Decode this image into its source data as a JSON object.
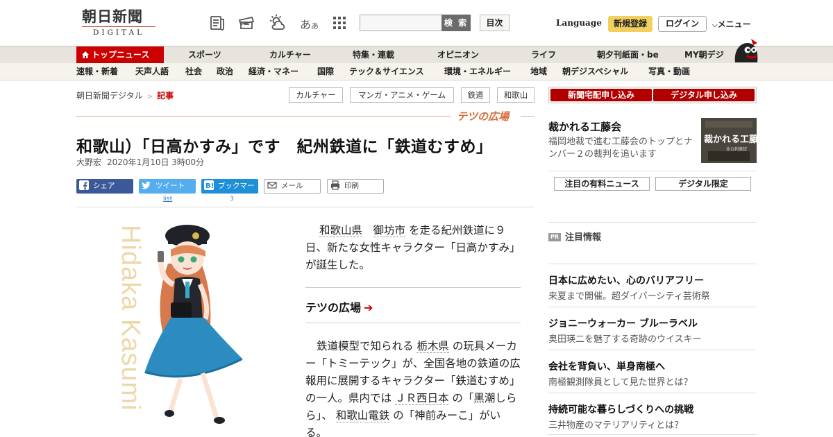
{
  "header": {
    "logo_jp": "朝日新聞",
    "logo_en": "DIGITAL",
    "font_size_mark": "あ",
    "font_size_mark_small": "あ",
    "search_placeholder": "",
    "search_button": "検 索",
    "toc_button": "目次",
    "language": "Language",
    "register_button": "新規登録",
    "login_button": "ログイン",
    "menu_button": "メニュー",
    "icons": [
      "newspaper-icon",
      "ticket-icon",
      "weather-icon",
      "font-size-icon",
      "grid-menu-icon"
    ]
  },
  "nav_primary": [
    "トップニュース",
    "スポーツ",
    "カルチャー",
    "特集・連載",
    "オピニオン",
    "ライフ",
    "朝夕刊紙面・be",
    "MY朝デジ"
  ],
  "nav_secondary": [
    "速報・新着",
    "天声人語",
    "社会",
    "政治",
    "経済・マネー",
    "国際",
    "テック＆サイエンス",
    "環境・エネルギー",
    "地域",
    "朝デジスペシャル",
    "写真・動画"
  ],
  "breadcrumb": {
    "site": "朝日新聞デジタル",
    "separator": ">",
    "current": "記事"
  },
  "tags": [
    "カルチャー",
    "マンガ・アニメ・ゲーム",
    "鉄道",
    "和歌山"
  ],
  "section_name": "テツの広場",
  "article": {
    "headline": "和歌山）「日高かすみ」です　紀州鉄道に「鉄道むすめ」",
    "author": "大野宏",
    "date": "2020年1月10日 3時00分",
    "share": {
      "facebook": "シェア",
      "twitter": "ツイート",
      "twitter_count": "list",
      "hatena": "ブックマーク",
      "hatena_count": "3",
      "mail": "メール",
      "print": "印刷"
    },
    "illustration_text": "Hidaka Kasumi",
    "p1_link1": "和歌山県",
    "p1_link2": "御坊市",
    "p1_rest": "を走る紀州鉄道に９日、新たな女性キャラクター「日高かすみ」が誕生した。",
    "related_link": "テツの広場",
    "p2_a": "鉄道模型で知られる",
    "p2_link1": "栃木県",
    "p2_b": "の玩具メーカー「トミーテック」が、全国各地の鉄道の広報用に展開するキャラクター「鉄道むすめ」の一人。県内では",
    "p2_link2": "ＪＲ西日本",
    "p2_c": "の「黒潮しらら」、",
    "p2_link3": "和歌山電鉄",
    "p2_d": "の「神前みーこ」がいる。"
  },
  "sidebar": {
    "subscribe_newspaper": "新聞宅配申し込み",
    "subscribe_digital": "デジタル申し込み",
    "feature_title": "裁かれる工藤会",
    "feature_desc": "福岡地裁で進む工藤会のトップとナンバー２の裁判を追います",
    "feature_image_title": "裁かれる工藤会",
    "feature_image_sub": "全公判速記",
    "tab_paid": "注目の有料ニュース",
    "tab_digital": "デジタル限定",
    "pr_badge": "PR",
    "pr_heading": "注目情報",
    "pr_items": [
      {
        "title": "日本に広めたい、心のバリアフリー",
        "desc": "来夏まで開催。超ダイバーシティ芸術祭"
      },
      {
        "title": "ジョニーウォーカー ブルーラベル",
        "desc": "奥田瑛二を魅了する奇跡のウイスキー"
      },
      {
        "title": "会社を背負い、単身南極へ",
        "desc": "南極観測隊員として見た世界とは？"
      },
      {
        "title": "持続可能な暮らしづくりへの挑戦",
        "desc": "三井物産のマテリアリティとは？"
      }
    ]
  },
  "colors": {
    "brand_red": "#c00000",
    "nav_bg": "#e6e4dc",
    "accent_orange": "#d76a3a",
    "facebook": "#3b5998",
    "twitter": "#55acee",
    "hatena": "#1f8fd8"
  }
}
